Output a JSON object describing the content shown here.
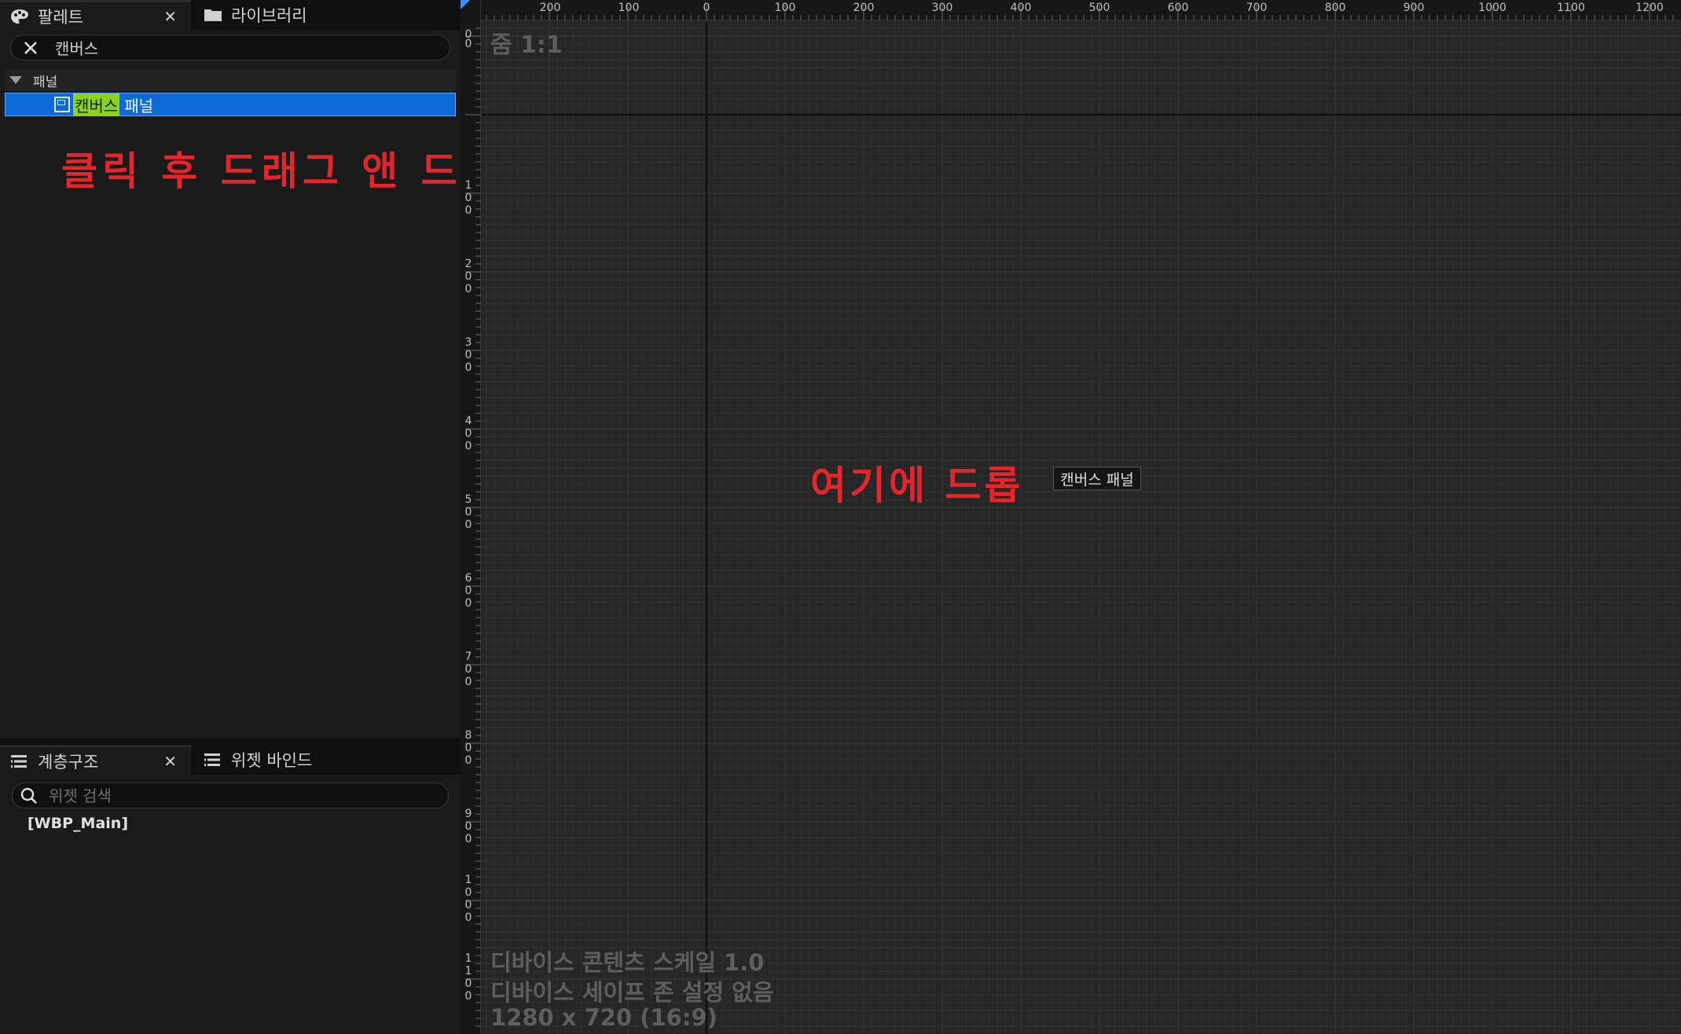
{
  "palette": {
    "tab_active": "팔레트",
    "tab_other": "라이브러리",
    "search_value": "캔버스",
    "category": "패널",
    "item_highlight": "캔버스",
    "item_rest": "패널"
  },
  "annotations": {
    "drag_note": "클릭 후 드래그 앤 드롭",
    "drop_note": "여기에 드롭"
  },
  "hierarchy": {
    "tab_active": "계층구조",
    "tab_other": "위젯 바인드",
    "search_placeholder": "위젯 검색",
    "root": "[WBP_Main]"
  },
  "viewport": {
    "zoom": "줌 1:1",
    "canvas_label": "캔버스 패널",
    "info_1": "디바이스 콘텐츠 스케일 1.0",
    "info_2": "디바이스 세이프 존 설정 없음",
    "info_3": "1280 x 720 (16:9)",
    "ruler_x": [
      "200",
      "100",
      "0",
      "100",
      "200",
      "300",
      "400",
      "500",
      "600",
      "700",
      "800",
      "900",
      "1000",
      "1100",
      "1200"
    ],
    "ruler_y": [
      "0",
      "0",
      "100",
      "200",
      "300",
      "400",
      "500",
      "600",
      "700",
      "800",
      "900",
      "1000",
      "1100"
    ]
  },
  "colors": {
    "accent": "#0e6ad6",
    "highlight": "#8fd11f",
    "annotation": "#e3262b"
  },
  "icons": {
    "palette_tab": "palette-icon",
    "library_tab": "folder-icon",
    "clear": "clear-icon",
    "hierarchy_tab": "list-icon",
    "bind_tab": "list-icon",
    "search": "search-icon",
    "widget": "widget-icon"
  }
}
